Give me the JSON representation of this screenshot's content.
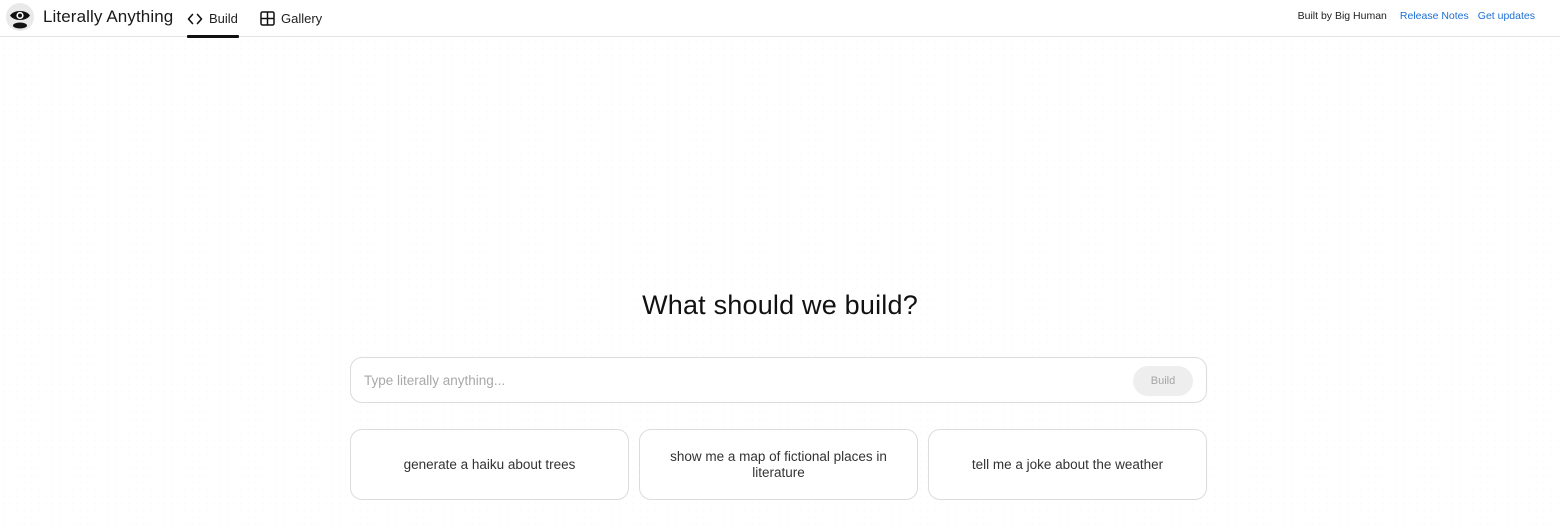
{
  "app": {
    "name": "Literally Anything",
    "logo_icon": "eye-logo-icon"
  },
  "nav": {
    "tabs": [
      {
        "label": "Build",
        "icon": "code-brackets-icon",
        "active": true
      },
      {
        "label": "Gallery",
        "icon": "grid-icon",
        "active": false
      }
    ]
  },
  "header_right": {
    "built_by": "Built by Big Human",
    "links": [
      "Release Notes",
      "Get updates"
    ],
    "link_color": "#1d6fd6"
  },
  "main": {
    "headline": "What should we build?",
    "prompt": {
      "placeholder": "Type literally anything...",
      "value": "",
      "button_label": "Build",
      "button_disabled": true
    },
    "suggestions": [
      "generate a haiku about trees",
      "show me a map of fictional places in literature",
      "tell me a joke about the weather"
    ]
  }
}
